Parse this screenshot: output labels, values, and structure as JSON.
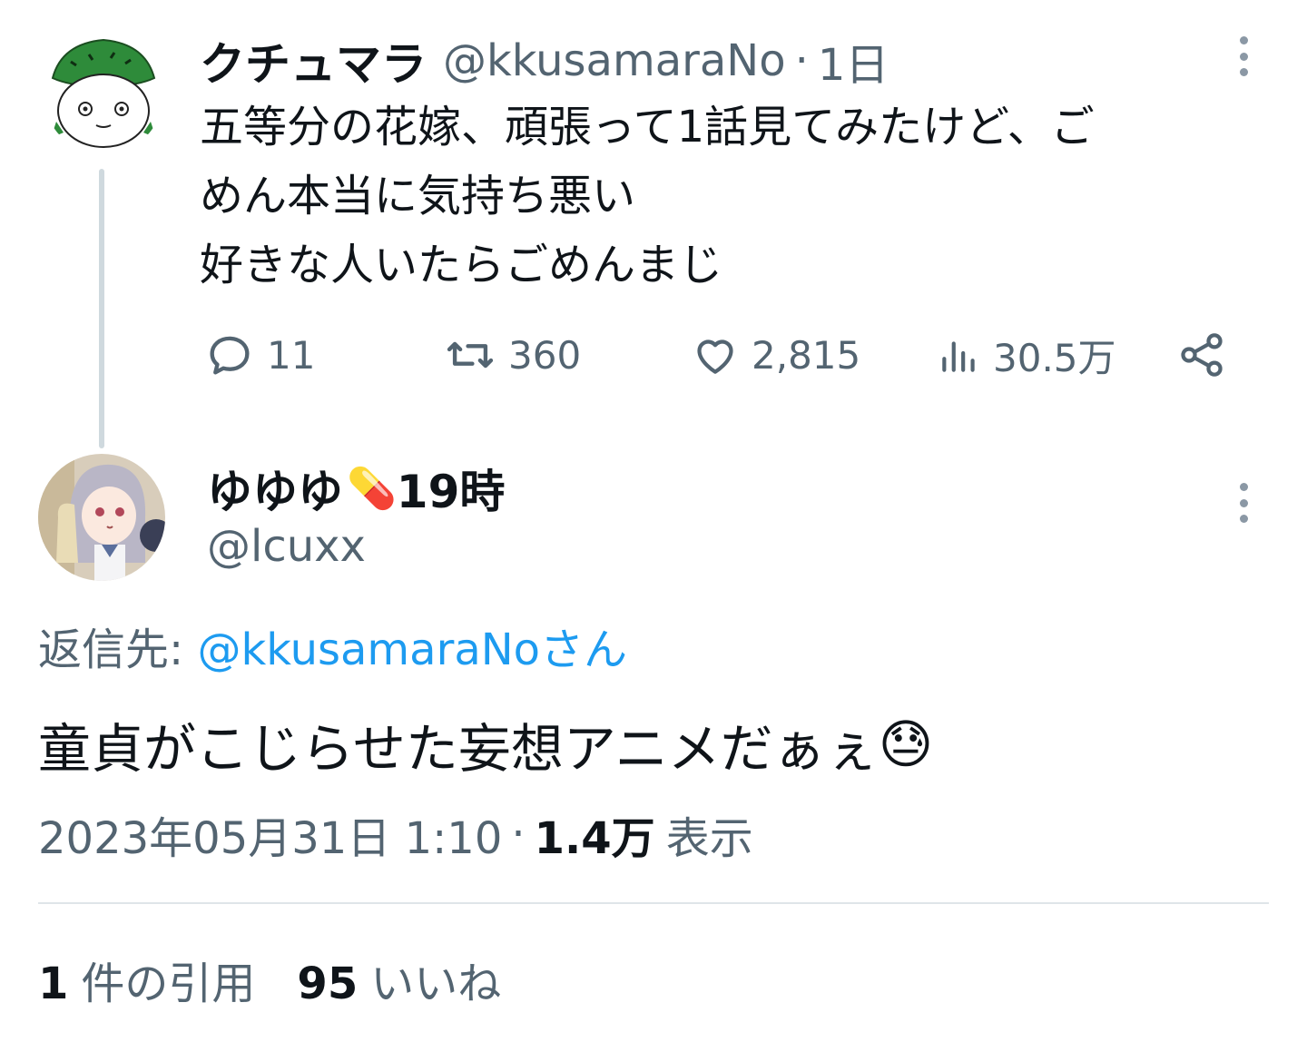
{
  "parent": {
    "display_name": "クチュマラ",
    "handle": "@kkusamaraNo",
    "separator": "·",
    "time_ago": "1日",
    "text_lines": [
      "五等分の花嫁、頑張って1話見てみたけど、ご",
      "めん本当に気持ち悪い",
      "好きな人いたらごめんまじ"
    ],
    "actions": {
      "replies": "11",
      "retweets": "360",
      "likes": "2,815",
      "views": "30.5万"
    }
  },
  "reply": {
    "display_name": "ゆゆゆ",
    "name_emoji": "💊",
    "name_suffix": "19時",
    "handle": "@lcuxx",
    "reply_to_label": "返信先:",
    "reply_to_handle": "@kkusamaraNoさん",
    "text": "童貞がこじらせた妄想アニメだぁぇ",
    "text_emoji": "😓",
    "timestamp": "2023年05月31日 1:10",
    "separator": "·",
    "views_count": "1.4万",
    "views_label": "表示",
    "quotes_count": "1",
    "quotes_label": "件の引用",
    "likes_count": "95",
    "likes_label": "いいね"
  },
  "colors": {
    "text_primary": "#0f1419",
    "text_secondary": "#536471",
    "link": "#1d9bf0",
    "divider": "#dfe5e9",
    "thread_line": "#cfd9de"
  },
  "icons": [
    "more-icon",
    "reply-icon",
    "retweet-icon",
    "like-icon",
    "views-icon",
    "share-icon"
  ]
}
